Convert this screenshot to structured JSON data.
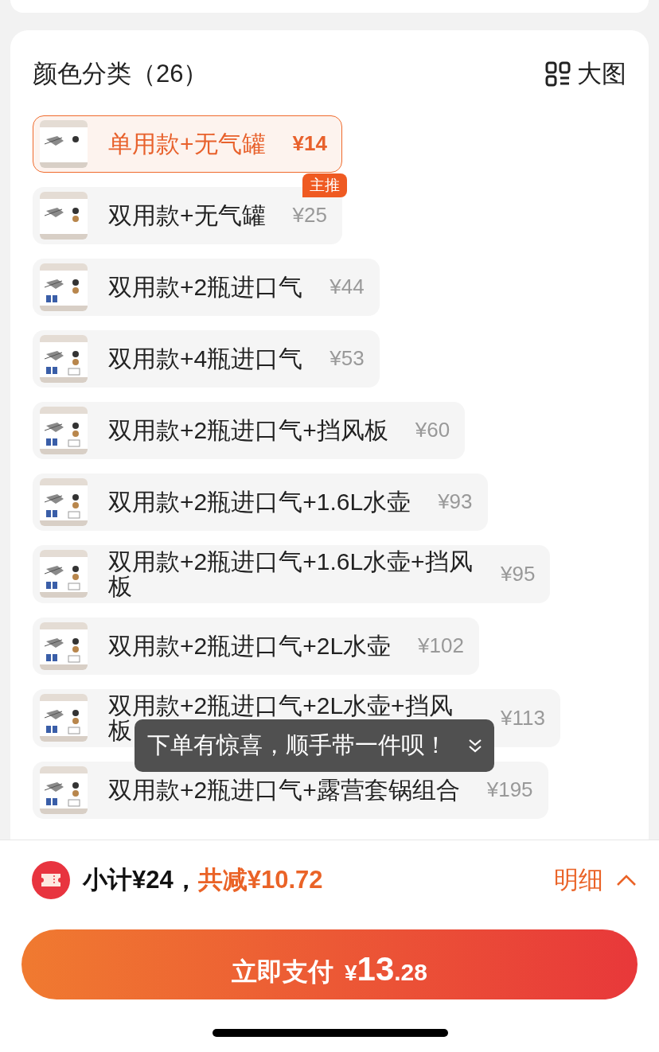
{
  "section": {
    "title": "颜色分类（26）",
    "view_toggle": "大图"
  },
  "options": [
    {
      "label": "单用款+无气罐",
      "price": "¥14",
      "selected": true
    },
    {
      "label": "双用款+无气罐",
      "price": "¥25",
      "selected": false,
      "badge": "主推"
    },
    {
      "label": "双用款+2瓶进口气",
      "price": "¥44",
      "selected": false
    },
    {
      "label": "双用款+4瓶进口气",
      "price": "¥53",
      "selected": false
    },
    {
      "label": "双用款+2瓶进口气+挡风板",
      "price": "¥60",
      "selected": false
    },
    {
      "label": "双用款+2瓶进口气+1.6L水壶",
      "price": "¥93",
      "selected": false
    },
    {
      "label": "双用款+2瓶进口气+1.6L水壶+挡风板",
      "price": "¥95",
      "selected": false
    },
    {
      "label": "双用款+2瓶进口气+2L水壶",
      "price": "¥102",
      "selected": false
    },
    {
      "label": "双用款+2瓶进口气+2L水壶+挡风板",
      "price": "¥113",
      "selected": false
    },
    {
      "label": "双用款+2瓶进口气+露营套锅组合",
      "price": "¥195",
      "selected": false
    }
  ],
  "toast": {
    "text": "下单有惊喜，顺手带一件呗！"
  },
  "summary": {
    "subtotal": "小计¥24，",
    "discount": "共减¥10.72",
    "details": "明细"
  },
  "pay_button": {
    "label": "立即支付",
    "currency": "¥",
    "integer": "13",
    "decimal": ".28"
  }
}
